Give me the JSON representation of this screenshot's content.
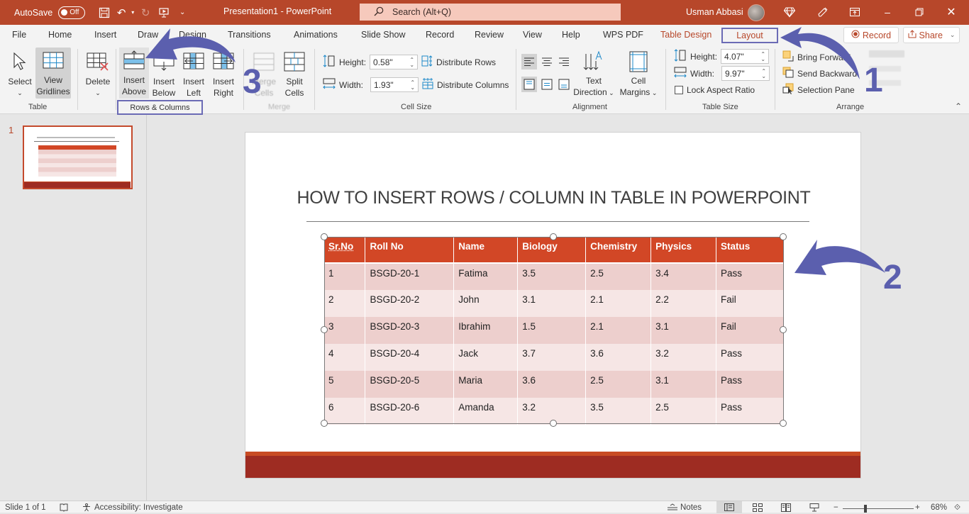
{
  "titlebar": {
    "autosave_label": "AutoSave",
    "autosave_state": "Off",
    "document_title": "Presentation1  -  PowerPoint",
    "search_placeholder": "Search (Alt+Q)",
    "user_name": "Usman Abbasi",
    "icons": [
      "save-icon",
      "undo-icon",
      "redo-icon",
      "present-icon",
      "customize-icon",
      "diamond-icon",
      "pen-icon",
      "ribbon-display-icon",
      "minimize-icon",
      "restore-icon",
      "close-icon"
    ]
  },
  "menubar": {
    "tabs": [
      "File",
      "Home",
      "Insert",
      "Draw",
      "Design",
      "Transitions",
      "Animations",
      "Slide Show",
      "Record",
      "Review",
      "View",
      "Help",
      "WPS PDF",
      "Table Design",
      "Layout"
    ],
    "active_tab": "Layout",
    "record_label": "Record",
    "share_label": "Share"
  },
  "ribbon": {
    "table_group": {
      "label": "Table",
      "select": "Select",
      "view": "View",
      "gridlines": "Gridlines"
    },
    "rows_columns_group": {
      "label": "Rows & Columns",
      "delete": "Delete",
      "insert_above": [
        "Insert",
        "Above"
      ],
      "insert_below": [
        "Insert",
        "Below"
      ],
      "insert_left": [
        "Insert",
        "Left"
      ],
      "insert_right": [
        "Insert",
        "Right"
      ]
    },
    "merge_group": {
      "label": "Merge",
      "merge_cells": [
        "Merge",
        "Cells"
      ],
      "split_cells": [
        "Split",
        "Cells"
      ]
    },
    "cell_size_group": {
      "label": "Cell Size",
      "height_label": "Height:",
      "height_value": "0.58\"",
      "width_label": "Width:",
      "width_value": "1.93\"",
      "distribute_rows": "Distribute Rows",
      "distribute_columns": "Distribute Columns"
    },
    "alignment_group": {
      "label": "Alignment",
      "text_direction": [
        "Text",
        "Direction"
      ],
      "cell_margins": [
        "Cell",
        "Margins"
      ]
    },
    "table_size_group": {
      "label": "Table Size",
      "height_label": "Height:",
      "height_value": "4.07\"",
      "width_label": "Width:",
      "width_value": "9.97\"",
      "lock_aspect": "Lock Aspect Ratio",
      "lock_aspect_checked": false
    },
    "arrange_group": {
      "label": "Arrange",
      "bring_forward": "Bring Forward",
      "send_backward": "Send Backward",
      "selection_pane": "Selection Pane"
    }
  },
  "thumbnails": [
    {
      "number": "1"
    }
  ],
  "slide": {
    "title": "HOW TO INSERT ROWS / COLUMN IN TABLE IN POWERPOINT",
    "table": {
      "headers": [
        "Sr.No",
        "Roll No",
        "Name",
        "Biology",
        "Chemistry",
        "Physics",
        "Status"
      ],
      "rows": [
        [
          "1",
          "BSGD-20-1",
          "Fatima",
          "3.5",
          "2.5",
          "3.4",
          "Pass"
        ],
        [
          "2",
          "BSGD-20-2",
          "John",
          "3.1",
          "2.1",
          "2.2",
          "Fail"
        ],
        [
          "3",
          "BSGD-20-3",
          "Ibrahim",
          "1.5",
          "2.1",
          "3.1",
          "Fail"
        ],
        [
          "4",
          "BSGD-20-4",
          "Jack",
          "3.7",
          "3.6",
          "3.2",
          "Pass"
        ],
        [
          "5",
          "BSGD-20-5",
          "Maria",
          "3.6",
          "2.5",
          "3.1",
          "Pass"
        ],
        [
          "6",
          "BSGD-20-6",
          "Amanda",
          "3.2",
          "3.5",
          "2.5",
          "Pass"
        ]
      ]
    }
  },
  "annotations": {
    "step1": "1",
    "step2": "2",
    "step3": "3",
    "color": "#5b5fae"
  },
  "statusbar": {
    "slide_info": "Slide 1 of 1",
    "accessibility": "Accessibility: Investigate",
    "notes": "Notes",
    "zoom": "68%"
  },
  "colors": {
    "accent": "#b7472a",
    "table_header": "#d24726",
    "row_dark": "#edcfcd",
    "row_light": "#f6e6e5",
    "footer": "#9e2c22"
  }
}
